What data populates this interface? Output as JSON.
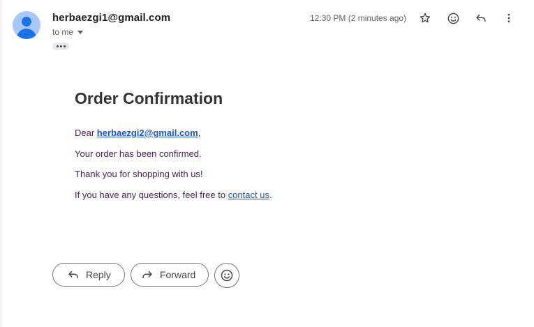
{
  "header": {
    "sender": "herbaezgi1@gmail.com",
    "to_label": "to me",
    "timestamp": "12:30 PM (2 minutes ago)"
  },
  "email": {
    "title": "Order Confirmation",
    "greeting_prefix": "Dear ",
    "recipient_email": "herbaezgi2@gmail.com",
    "greeting_suffix": ",",
    "line_confirmed": "Your order has been confirmed.",
    "line_thanks": "Thank you for shopping with us!",
    "questions_prefix": "If you have any questions, feel free to ",
    "contact_link": "contact us",
    "questions_suffix": "."
  },
  "actions": {
    "reply_label": "Reply",
    "forward_label": "Forward"
  },
  "icons": {
    "star": "star-icon",
    "emoji": "emoji-icon",
    "reply": "reply-icon",
    "more": "more-vert-icon"
  },
  "colors": {
    "link": "#1a55c9",
    "body_text": "#4a1d5a",
    "avatar_bg": "#a8c7fa",
    "avatar_fg": "#1a73e8"
  }
}
